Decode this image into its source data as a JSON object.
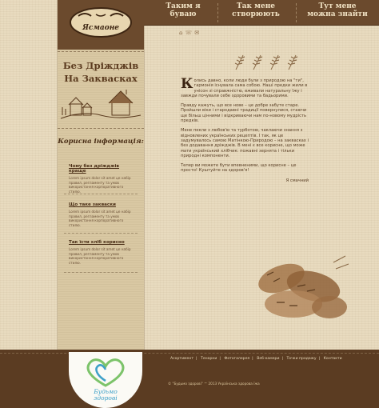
{
  "header": {
    "logo_text": "Ясмаоне",
    "nav": [
      {
        "label_line1": "Таким я",
        "label_line2": "буваю"
      },
      {
        "label_line1": "Так мене",
        "label_line2": "створюють"
      },
      {
        "label_line1": "Тут мене",
        "label_line2": "можна знайти"
      }
    ]
  },
  "sidebar": {
    "slogan_line1": "Без Дріжджів",
    "slogan_line2": "На Заквасках",
    "info_title": "Корисна інформація:",
    "articles": [
      {
        "title": "Чому без дріжджів краще",
        "desc": "Lorem ipsum dolor sit amet це набір правил, регламенту та умов використання корпоративного стилю."
      },
      {
        "title": "Що таке закваски",
        "desc": "Lorem ipsum dolor sit amet це набір правил, регламенту та умов використання корпоративного стилю."
      },
      {
        "title": "Так їсти хліб корисно",
        "desc": "Lorem ipsum dolor sit amet це набір правил, регламенту та умов використання корпоративного стилю."
      }
    ]
  },
  "content": {
    "dropcap": "К",
    "p1": "олись давно, коли люди були з природою на \"ти\", гармонія існувала сама собою. Наші предки жили в унісон зі справжністю, вживали натуральну їжу і завжди почували себе здоровими та бадьорими.",
    "p2": "Правду кажуть, що все нове – це добре забуте старе. Пройшли віки і стародавні традиції повернулися, стаючи ще більш цінними і відкриваючи нам по-новому мудрість предків.",
    "p3": "Мене пекли з любов'ю та турботою, чаклаючи знання з відновлених українських рецептів. І так, як це задумувалось самою Матінкою-Природою – на заквасках і без додавання дріжджів. В мені є все корисне, що може мати український хлібчик: пожавні зернята і тільки природні компоненти.",
    "p4": "Тепер ви можете бути впевненими, що корисне – це просто! Куштуйте на здоров'я!",
    "signature": "Я смачний",
    "icons": [
      "home-icon",
      "phone-icon",
      "mail-icon"
    ]
  },
  "footer": {
    "menu": [
      "Асортимент",
      "Тенарни",
      "Фотогалерея",
      "Веб-камери",
      "Точки продажу",
      "Контакти"
    ],
    "copyright": "© \"Будьмо здорові\" ™ 2013 Українська здорова їжа",
    "badge_text_line1": "Будьмо",
    "badge_text_line2": "здорові"
  },
  "colors": {
    "brown": "#6b4a2d",
    "dark_brown": "#5b3c22",
    "paper": "#e8dbbf",
    "badge_blue": "#3ea0c8",
    "badge_green": "#7cc36a"
  }
}
